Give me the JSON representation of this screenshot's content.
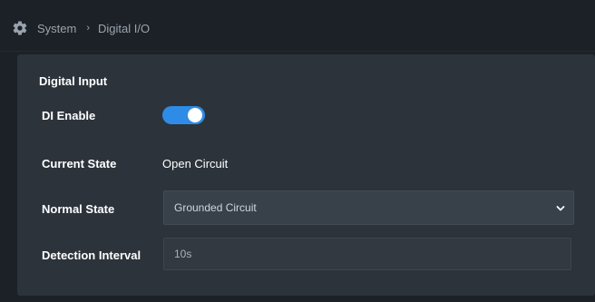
{
  "breadcrumb": {
    "icon": "gear-icon",
    "items": [
      "System",
      "Digital I/O"
    ],
    "separator": "›"
  },
  "section": {
    "title": "Digital Input"
  },
  "di_enable": {
    "label": "DI Enable",
    "enabled": true,
    "accent_color": "#2f8ce6"
  },
  "current_state": {
    "label": "Current State",
    "value": "Open Circuit"
  },
  "normal_state": {
    "label": "Normal State",
    "selected": "Grounded Circuit"
  },
  "detection_interval": {
    "label": "Detection Interval",
    "value": "10s"
  }
}
